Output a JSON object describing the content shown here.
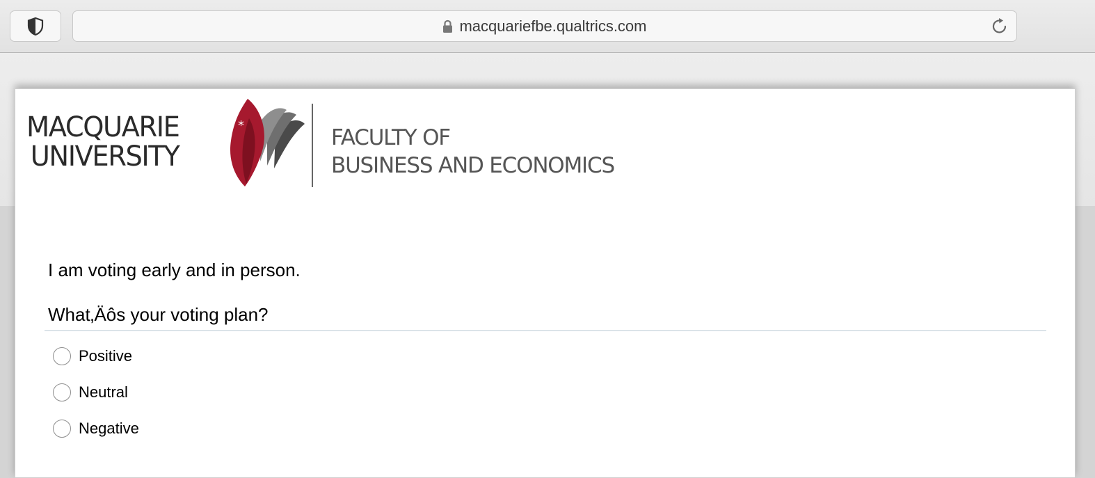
{
  "browser": {
    "url": "macquariefbe.qualtrics.com",
    "shield_icon": "shield-icon",
    "lock_icon": "lock-icon",
    "reload_icon": "reload-icon"
  },
  "header": {
    "university_line1": "MACQUARIE",
    "university_line2": "UNIVERSITY",
    "faculty_line1": "FACULTY OF",
    "faculty_line2": "BUSINESS AND ECONOMICS",
    "brand_color": "#a6192e"
  },
  "survey": {
    "statement": "I am voting early and in person.",
    "question": "What‚Äôs your voting plan?",
    "options": [
      "Positive",
      "Neutral",
      "Negative"
    ]
  }
}
